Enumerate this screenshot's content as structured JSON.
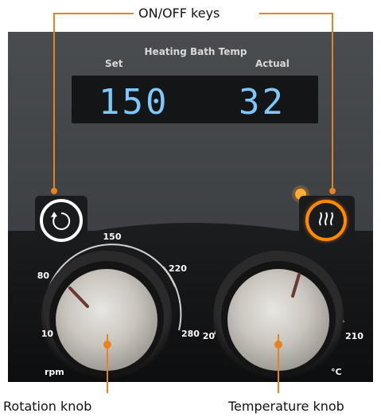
{
  "callouts": {
    "keys_label": "ON/OFF keys",
    "rotation_label": "Rotation knob",
    "temperature_label": "Temperature knob"
  },
  "display": {
    "title": "Heating Bath Temp",
    "set_label": "Set",
    "actual_label": "Actual",
    "set_value": "150",
    "actual_value": "32"
  },
  "rotation_dial": {
    "ticks": [
      "10",
      "80",
      "150",
      "220",
      "280"
    ],
    "unit": "rpm"
  },
  "temperature_dial": {
    "ticks": [
      "20",
      "210"
    ],
    "unit": "°C"
  },
  "icons": {
    "rotation_key": "rotate-icon",
    "heating_key": "heating-icon"
  },
  "colors": {
    "panel": "#3a3d40",
    "callout": "#e8821e",
    "display_digits": "#7cc8ff",
    "heat_ring": "#ff8a00",
    "rotation_ring": "#ffffff"
  }
}
